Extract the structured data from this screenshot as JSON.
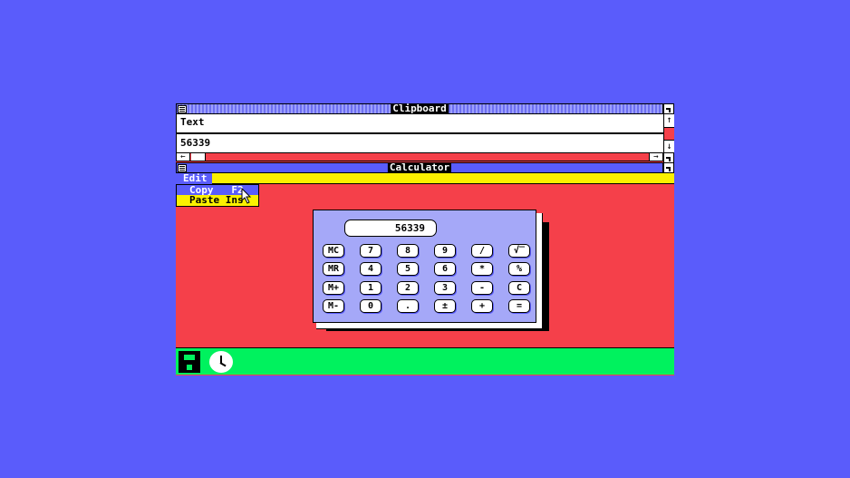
{
  "clipboard": {
    "title": "Clipboard",
    "format_label": "Text",
    "content": "56339",
    "scroll_up": "↑",
    "scroll_down": "↓",
    "scroll_left": "←",
    "scroll_right": "→"
  },
  "calculator": {
    "title": "Calculator",
    "menu": {
      "edit_label": "Edit"
    },
    "edit_menu": {
      "items": [
        {
          "label": "Copy   F2",
          "selected": true
        },
        {
          "label": "Paste Ins",
          "selected": false
        }
      ]
    },
    "display": "56339",
    "keys": [
      [
        "MC",
        "7",
        "8",
        "9",
        "/",
        "√‾"
      ],
      [
        "MR",
        "4",
        "5",
        "6",
        "*",
        "%"
      ],
      [
        "M+",
        "1",
        "2",
        "3",
        "-",
        "C"
      ],
      [
        "M-",
        "0",
        ".",
        "±",
        "+",
        "="
      ]
    ]
  },
  "colors": {
    "desktop": "#5a5cfb",
    "workspace": "#f5404a",
    "menubar": "#fbf000",
    "iconbar": "#00f25e",
    "calculator_body": "#a5a8f8"
  },
  "icon_bar": {
    "icons": [
      "disk-icon",
      "clock-icon"
    ]
  }
}
